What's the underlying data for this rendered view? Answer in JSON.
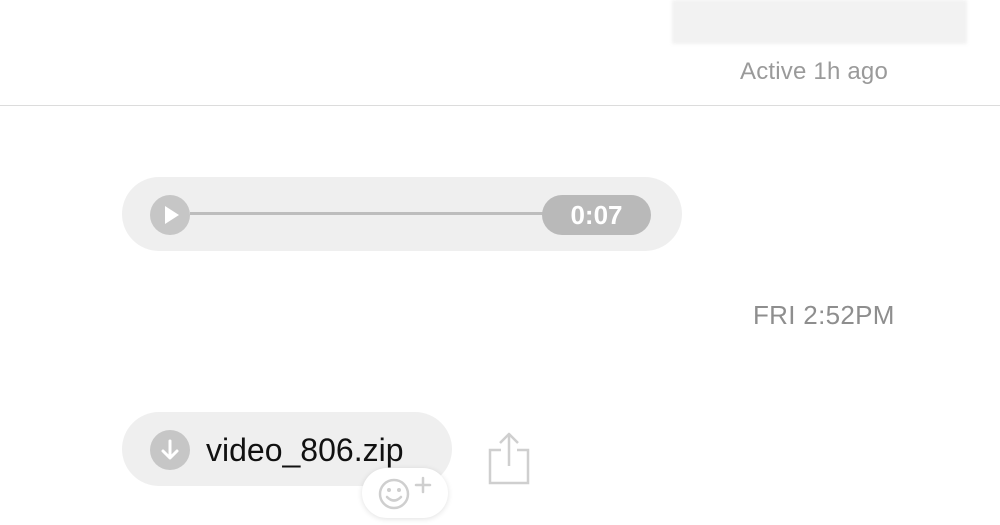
{
  "header": {
    "status": "Active 1h ago"
  },
  "audio_message": {
    "duration": "0:07",
    "progress": 0.0,
    "play_icon": "play-icon"
  },
  "timestamp": "FRI 2:52PM",
  "file_message": {
    "file_name": "video_806.zip",
    "download_icon": "download-icon"
  },
  "actions": {
    "share_icon": "share-icon",
    "reaction_icon": "add-reaction-icon"
  },
  "colors": {
    "bubble": "#efefef",
    "icon_gray": "#c6c6c6",
    "duration_badge": "#b9b9b9",
    "muted_text": "#9a9a9a"
  }
}
